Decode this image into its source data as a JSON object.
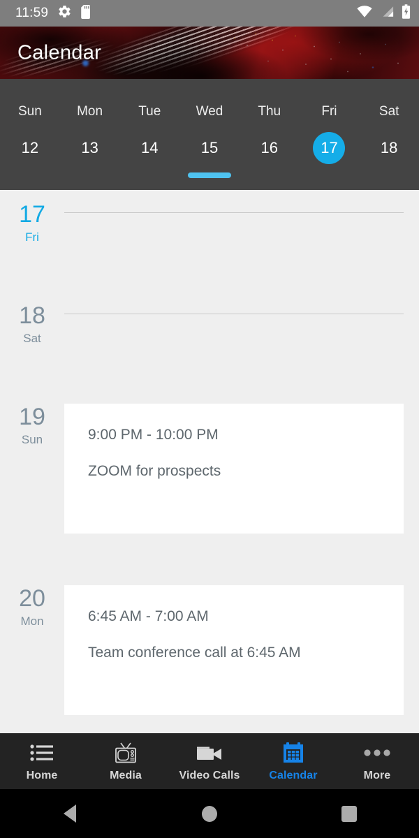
{
  "status_bar": {
    "time": "11:59",
    "left_icons": [
      "gear-icon",
      "sd-card-icon"
    ],
    "right_icons": [
      "wifi-icon",
      "cellular-signal-icon",
      "battery-charging-icon"
    ]
  },
  "header": {
    "title": "Calendar",
    "background": "arena-crowd-photo"
  },
  "week_strip": {
    "background_color": "#444444",
    "accent_color": "#15ADE8",
    "days": [
      {
        "dow": "Sun",
        "num": "12",
        "selected": false
      },
      {
        "dow": "Mon",
        "num": "13",
        "selected": false
      },
      {
        "dow": "Tue",
        "num": "14",
        "selected": false
      },
      {
        "dow": "Wed",
        "num": "15",
        "selected": false
      },
      {
        "dow": "Thu",
        "num": "16",
        "selected": false
      },
      {
        "dow": "Fri",
        "num": "17",
        "selected": true
      },
      {
        "dow": "Sat",
        "num": "18",
        "selected": false
      }
    ]
  },
  "agenda": {
    "today_color": "#13AAE4",
    "day_color": "#7D8E9B",
    "days": [
      {
        "num": "17",
        "dow": "Fri",
        "is_today": true,
        "events": []
      },
      {
        "num": "18",
        "dow": "Sat",
        "is_today": false,
        "events": []
      },
      {
        "num": "19",
        "dow": "Sun",
        "is_today": false,
        "events": [
          {
            "time": "9:00 PM - 10:00 PM",
            "title": "ZOOM for prospects"
          }
        ]
      },
      {
        "num": "20",
        "dow": "Mon",
        "is_today": false,
        "events": [
          {
            "time": "6:45 AM - 7:00 AM",
            "title": "Team conference call at 6:45 AM"
          }
        ]
      }
    ]
  },
  "bottom_nav": {
    "active_color": "#1683E8",
    "items": [
      {
        "label": "Home",
        "icon": "list-icon",
        "active": false
      },
      {
        "label": "Media",
        "icon": "tv-icon",
        "active": false
      },
      {
        "label": "Video Calls",
        "icon": "video-camera-icon",
        "active": false
      },
      {
        "label": "Calendar",
        "icon": "calendar-icon",
        "active": true
      },
      {
        "label": "More",
        "icon": "three-dots-icon",
        "active": false
      }
    ]
  },
  "system_nav": {
    "buttons": [
      "back-icon",
      "home-icon",
      "recents-icon"
    ]
  }
}
